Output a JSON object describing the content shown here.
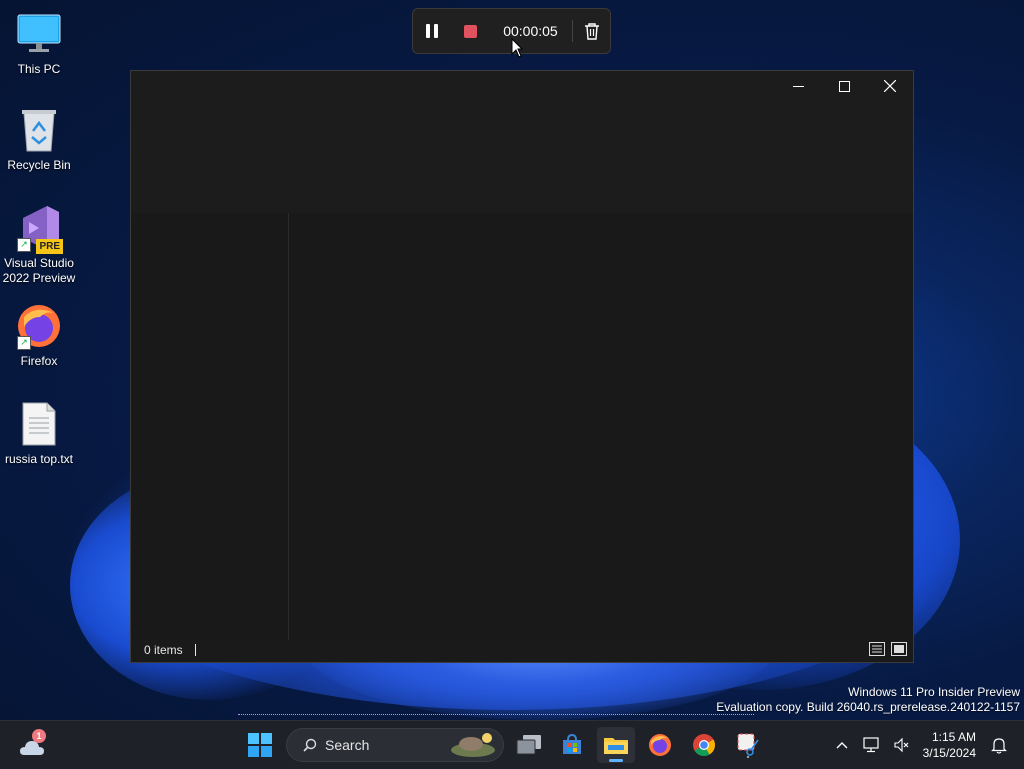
{
  "desktop": {
    "icons": [
      {
        "label": "This PC",
        "icon": "monitor-icon"
      },
      {
        "label": "Recycle Bin",
        "icon": "recycle-bin-icon"
      },
      {
        "label": "Visual Studio 2022 Preview",
        "icon": "visual-studio-icon",
        "badge": "PRE"
      },
      {
        "label": "Firefox",
        "icon": "firefox-icon"
      },
      {
        "label": "russia top.txt",
        "icon": "text-file-icon"
      }
    ]
  },
  "recorder": {
    "time": "00:00:05",
    "colors": {
      "stop": "#e0525d"
    }
  },
  "explorer": {
    "status_text": "0 items"
  },
  "watermark": {
    "line1": "Windows 11 Pro Insider Preview",
    "line2": "Evaluation copy. Build 26040.rs_prerelease.240122-1157"
  },
  "taskbar": {
    "widget_badge": "1",
    "search_placeholder": "Search",
    "apps": [
      "start-icon",
      "task-view-icon",
      "microsoft-store-icon",
      "file-explorer-icon",
      "firefox-icon",
      "chrome-icon",
      "snipping-tool-icon"
    ],
    "active_app": "file-explorer-icon",
    "clock": {
      "time": "1:15 AM",
      "date": "3/15/2024"
    }
  }
}
